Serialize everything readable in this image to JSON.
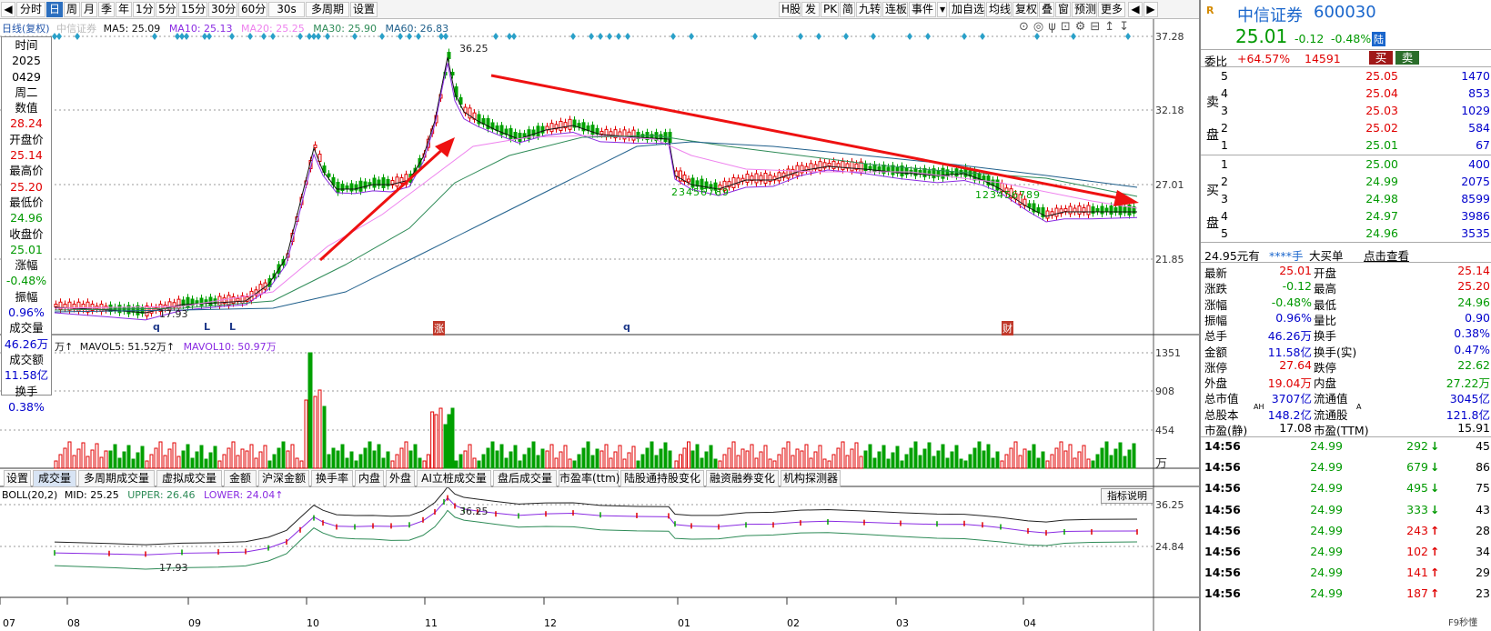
{
  "toolbar": {
    "left": [
      "分时",
      "日",
      "周",
      "月",
      "季",
      "年",
      "1分",
      "5分",
      "15分",
      "30分",
      "60分",
      "30s",
      "多周期",
      "设置"
    ],
    "right": [
      "H股",
      "发",
      "PK",
      "简",
      "九转",
      "连板",
      "事件",
      "加自选",
      "均线",
      "复权",
      "叠",
      "窗",
      "预测",
      "更多"
    ],
    "scroll_left": "◀",
    "scroll_right": "▶",
    "more": "▼"
  },
  "legend": {
    "title": "日线(复权)",
    "broker": "中信证券",
    "ma5": "MA5: 25.09",
    "ma10": "MA10: 25.13",
    "ma20": "MA20: 25.25",
    "ma30": "MA30: 25.90",
    "ma60": "MA60: 26.83"
  },
  "price_axis": [
    "37.28",
    "32.18",
    "27.01",
    "21.85"
  ],
  "high_label": "36.25",
  "low_label": "17.93",
  "tops_glyphs": [
    "⊙",
    "◎",
    "ψ",
    "⊡",
    "⚙",
    "⊟",
    "↥",
    "↧"
  ],
  "dw": [
    "时间",
    "2025",
    "0429",
    "周二",
    "数值",
    "28.24",
    "开盘价",
    "25.14",
    "最高价",
    "25.20",
    "最低价",
    "24.96",
    "收盘价",
    "25.01",
    "涨幅",
    "-0.48%",
    "振幅",
    "0.96%",
    "成交量",
    "46.26万",
    "成交额",
    "11.58亿",
    "换手",
    "0.38%"
  ],
  "event_marks": {
    "q1": "q",
    "l1": "L",
    "l2": "L",
    "zhang": "涨",
    "q2": "q",
    "cai": "财"
  },
  "vol_legend": {
    "unit": "万↑",
    "mavol5": "MAVOL5: 51.52万↑",
    "mavol10": "MAVOL10: 50.97万"
  },
  "vol_axis": [
    "1351",
    "908",
    "454",
    "万"
  ],
  "ind_tabs": [
    "设置",
    "成交量",
    "多周期成交量",
    "虚拟成交量",
    "金额",
    "沪深金额",
    "换手率",
    "内盘",
    "外盘",
    "AI立桩成交量",
    "盘后成交量",
    "市盈率(ttm)",
    "陆股通持股变化",
    "融资融券变化",
    "机构探测器"
  ],
  "boll_legend": {
    "name": "BOLL(20,2)",
    "mid": "MID: 25.25",
    "upper": "UPPER: 26.46",
    "lower": "LOWER: 24.04↑"
  },
  "boll_axis": [
    "36.25",
    "24.84"
  ],
  "help_button": "指标说明",
  "x_axis": [
    "07",
    "08",
    "09",
    "10",
    "11",
    "12",
    "01",
    "02",
    "03",
    "04"
  ],
  "td_green": [
    "1",
    "2",
    "3",
    "4",
    "5",
    "6",
    "7",
    "8",
    "9"
  ],
  "right": {
    "logo": "R",
    "name": "中信证券",
    "code": "600030",
    "price": "25.01",
    "change": "-0.12",
    "pct": "-0.48%",
    "tag": "陆",
    "weibi_label": "委比",
    "weibi_val": "+64.57%",
    "weibi_diff": "14591",
    "buy_btn": "买",
    "sell_btn": "卖",
    "sell_side": "卖盘",
    "buy_side": "买盘",
    "asks": [
      {
        "lv": "5",
        "p": "25.05",
        "v": "1470"
      },
      {
        "lv": "4",
        "p": "25.04",
        "v": "853"
      },
      {
        "lv": "3",
        "p": "25.03",
        "v": "1029"
      },
      {
        "lv": "2",
        "p": "25.02",
        "v": "584"
      },
      {
        "lv": "1",
        "p": "25.01",
        "v": "67"
      }
    ],
    "bids": [
      {
        "lv": "1",
        "p": "25.00",
        "v": "400"
      },
      {
        "lv": "2",
        "p": "24.99",
        "v": "2075"
      },
      {
        "lv": "3",
        "p": "24.98",
        "v": "8599"
      },
      {
        "lv": "4",
        "p": "24.97",
        "v": "3986"
      },
      {
        "lv": "5",
        "p": "24.96",
        "v": "3535"
      }
    ],
    "big_order": {
      "a": "24.95元有",
      "b": "****手",
      "c": "大买单",
      "d": "点击查看"
    },
    "stats": [
      [
        "最新",
        "25.01",
        "开盘",
        "25.14"
      ],
      [
        "涨跌",
        "-0.12",
        "最高",
        "25.20"
      ],
      [
        "涨幅",
        "-0.48%",
        "最低",
        "24.96"
      ],
      [
        "振幅",
        "0.96%",
        "量比",
        "0.90"
      ],
      [
        "总手",
        "46.26万",
        "换手",
        "0.38%"
      ],
      [
        "金额",
        "11.58亿",
        "换手(实)",
        "0.47%"
      ],
      [
        "涨停",
        "27.64",
        "跌停",
        "22.62"
      ],
      [
        "外盘",
        "19.04万",
        "内盘",
        "27.22万"
      ],
      [
        "总市值",
        "3707亿",
        "流通值",
        "3045亿"
      ],
      [
        "总股本",
        "148.2亿",
        "流通股",
        "121.8亿"
      ],
      [
        "市盈(静)",
        "17.08",
        "市盈(TTM)",
        "15.91"
      ]
    ],
    "ah": "AH",
    "a_tag": "A",
    "ticks": [
      {
        "t": "14:56",
        "p": "24.99",
        "v": "292",
        "d": "↓",
        "n": "45"
      },
      {
        "t": "14:56",
        "p": "24.99",
        "v": "679",
        "d": "↓",
        "n": "86"
      },
      {
        "t": "14:56",
        "p": "24.99",
        "v": "495",
        "d": "↓",
        "n": "75"
      },
      {
        "t": "14:56",
        "p": "24.99",
        "v": "333",
        "d": "↓",
        "n": "43"
      },
      {
        "t": "14:56",
        "p": "24.99",
        "v": "243",
        "d": "↑",
        "n": "28"
      },
      {
        "t": "14:56",
        "p": "24.99",
        "v": "102",
        "d": "↑",
        "n": "34"
      },
      {
        "t": "14:56",
        "p": "24.99",
        "v": "141",
        "d": "↑",
        "n": "29"
      },
      {
        "t": "14:56",
        "p": "24.99",
        "v": "187",
        "d": "↑",
        "n": "23"
      }
    ],
    "watermark": "F9秒懂"
  },
  "colors": {
    "up": "#e00000",
    "down": "#00a000",
    "ma5": "#111111",
    "ma10": "#8a2be2",
    "ma20": "#ee82ee",
    "ma30": "#2e8b57",
    "ma60": "#1f5f8b",
    "arrow": "#ee1111"
  }
}
